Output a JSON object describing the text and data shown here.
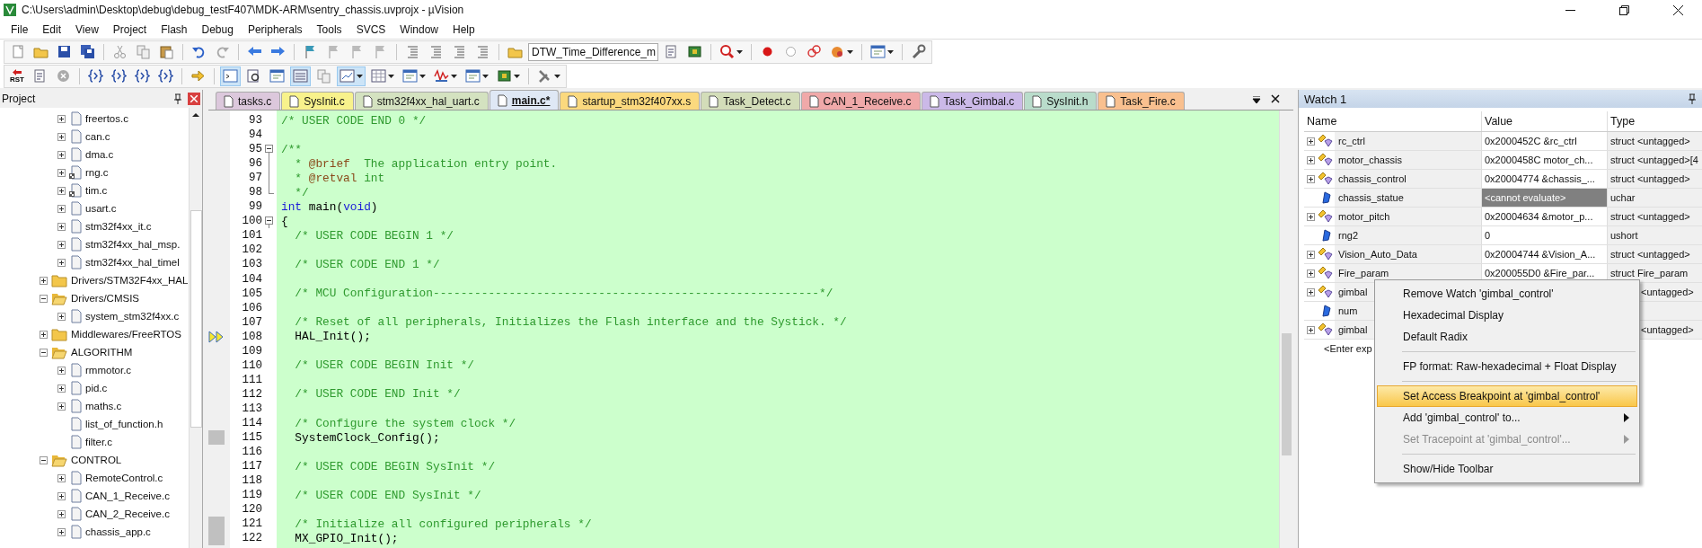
{
  "window": {
    "title": "C:\\Users\\admin\\Desktop\\debug\\debug_testF407\\MDK-ARM\\sentry_chassis.uvprojx - µVision"
  },
  "menu": [
    "File",
    "Edit",
    "View",
    "Project",
    "Flash",
    "Debug",
    "Peripherals",
    "Tools",
    "SVCS",
    "Window",
    "Help"
  ],
  "toolbar": {
    "target": "DTW_Time_Difference_m",
    "reset_label": "RST"
  },
  "project": {
    "title": "Project",
    "tree": [
      {
        "children": [
          {
            "label": "freertos.c",
            "expanded": false
          },
          {
            "label": "can.c",
            "expanded": false
          },
          {
            "label": "dma.c",
            "expanded": false
          },
          {
            "label": "rng.c",
            "expanded": false,
            "options": true
          },
          {
            "label": "tim.c",
            "expanded": false,
            "options": true
          },
          {
            "label": "usart.c",
            "expanded": false
          },
          {
            "label": "stm32f4xx_it.c",
            "expanded": false
          },
          {
            "label": "stm32f4xx_hal_msp.",
            "expanded": false
          },
          {
            "label": "stm32f4xx_hal_timel",
            "expanded": false
          }
        ]
      },
      {
        "label": "Drivers/STM32F4xx_HAL",
        "expanded": false,
        "folder": true
      },
      {
        "label": "Drivers/CMSIS",
        "expanded": true,
        "folder": true,
        "children": [
          {
            "label": "system_stm32f4xx.c",
            "expanded": false
          }
        ]
      },
      {
        "label": "Middlewares/FreeRTOS",
        "expanded": false,
        "folder": true
      },
      {
        "label": "ALGORITHM",
        "expanded": true,
        "folder": true,
        "children": [
          {
            "label": "rmmotor.c",
            "expanded": false
          },
          {
            "label": "pid.c",
            "expanded": false
          },
          {
            "label": "maths.c",
            "expanded": false
          },
          {
            "label": "list_of_function.h"
          },
          {
            "label": "filter.c"
          }
        ]
      },
      {
        "label": "CONTROL",
        "expanded": true,
        "folder": true,
        "children": [
          {
            "label": "RemoteControl.c",
            "expanded": false
          },
          {
            "label": "CAN_1_Receive.c",
            "expanded": false
          },
          {
            "label": "CAN_2_Receive.c",
            "expanded": false
          },
          {
            "label": "chassis_app.c",
            "expanded": false
          }
        ]
      }
    ]
  },
  "tabs": [
    {
      "label": "tasks.c",
      "color": "#dcc8dc",
      "selected": false
    },
    {
      "label": "SysInit.c",
      "color": "#f8f28c",
      "selected": false
    },
    {
      "label": "stm32f4xx_hal_uart.c",
      "color": "#d4e2c0",
      "selected": false
    },
    {
      "label": "main.c*",
      "color": "#dfe8f5",
      "selected": true
    },
    {
      "label": "startup_stm32f407xx.s",
      "color": "#fbd97e",
      "selected": false
    },
    {
      "label": "Task_Detect.c",
      "color": "#d3ddb9",
      "selected": false
    },
    {
      "label": "CAN_1_Receive.c",
      "color": "#f0a9a9",
      "selected": false
    },
    {
      "label": "Task_Gimbal.c",
      "color": "#cbb9e8",
      "selected": false
    },
    {
      "label": "SysInit.h",
      "color": "#b9dccb",
      "selected": false
    },
    {
      "label": "Task_Fire.c",
      "color": "#f9c08f",
      "selected": false
    }
  ],
  "code": [
    {
      "number": "93",
      "segments": [
        {
          "kind": "comment",
          "text": "/* USER CODE END 0 */"
        }
      ]
    },
    {
      "number": "94"
    },
    {
      "number": "95",
      "fold_start": true,
      "segments": [
        {
          "kind": "comment",
          "text": "/**"
        }
      ]
    },
    {
      "number": "96",
      "in_fold": true,
      "segments": [
        {
          "kind": "comment",
          "text": "  * "
        },
        {
          "kind": "tag",
          "text": "@brief"
        },
        {
          "kind": "comment",
          "text": "  The application entry point."
        }
      ]
    },
    {
      "number": "97",
      "in_fold": true,
      "segments": [
        {
          "kind": "comment",
          "text": "  * "
        },
        {
          "kind": "tag",
          "text": "@retval"
        },
        {
          "kind": "comment",
          "text": " int"
        }
      ]
    },
    {
      "number": "98",
      "fold_end": true,
      "segments": [
        {
          "kind": "comment",
          "text": "  */"
        }
      ]
    },
    {
      "number": "99",
      "segments": [
        {
          "kind": "keyword",
          "text": "int"
        },
        {
          "kind": "code",
          "text": " main("
        },
        {
          "kind": "keyword",
          "text": "void"
        },
        {
          "kind": "code",
          "text": ")"
        }
      ]
    },
    {
      "number": "100",
      "fold_start": true,
      "segments": [
        {
          "kind": "code",
          "text": "{"
        }
      ]
    },
    {
      "number": "101",
      "segments": [
        {
          "kind": "comment",
          "text": "  /* USER CODE BEGIN 1 */"
        }
      ]
    },
    {
      "number": "102"
    },
    {
      "number": "103",
      "segments": [
        {
          "kind": "comment",
          "text": "  /* USER CODE END 1 */"
        }
      ]
    },
    {
      "number": "104"
    },
    {
      "number": "105",
      "segments": [
        {
          "kind": "comment",
          "text": "  /* MCU Configuration--------------------------------------------------------*/"
        }
      ]
    },
    {
      "number": "106"
    },
    {
      "number": "107",
      "segments": [
        {
          "kind": "comment",
          "text": "  /* Reset of all peripherals, Initializes the Flash interface and the Systick. */"
        }
      ]
    },
    {
      "number": "108",
      "current": true,
      "segments": [
        {
          "kind": "code",
          "text": "  HAL_Init();"
        }
      ]
    },
    {
      "number": "109"
    },
    {
      "number": "110",
      "segments": [
        {
          "kind": "comment",
          "text": "  /* USER CODE BEGIN Init */"
        }
      ]
    },
    {
      "number": "111"
    },
    {
      "number": "112",
      "segments": [
        {
          "kind": "comment",
          "text": "  /* USER CODE END Init */"
        }
      ]
    },
    {
      "number": "113"
    },
    {
      "number": "114",
      "segments": [
        {
          "kind": "comment",
          "text": "  /* Configure the system clock */"
        }
      ]
    },
    {
      "number": "115",
      "executable": true,
      "segments": [
        {
          "kind": "code",
          "text": "  SystemClock_Config();"
        }
      ]
    },
    {
      "number": "116"
    },
    {
      "number": "117",
      "segments": [
        {
          "kind": "comment",
          "text": "  /* USER CODE BEGIN SysInit */"
        }
      ]
    },
    {
      "number": "118"
    },
    {
      "number": "119",
      "segments": [
        {
          "kind": "comment",
          "text": "  /* USER CODE END SysInit */"
        }
      ]
    },
    {
      "number": "120"
    },
    {
      "number": "121",
      "executable": true,
      "segments": [
        {
          "kind": "comment",
          "text": "  /* Initialize all configured peripherals */"
        }
      ]
    },
    {
      "number": "122",
      "executable": true,
      "segments": [
        {
          "kind": "code",
          "text": "  MX_GPIO_Init();"
        }
      ]
    }
  ],
  "watch": {
    "title": "Watch 1",
    "columns": [
      "Name",
      "Value",
      "Type"
    ],
    "rows": [
      {
        "name": "rc_ctrl",
        "value": "0x2000452C &rc_ctrl",
        "type": "struct <untagged>",
        "kind": "struct",
        "expanded": false
      },
      {
        "name": "motor_chassis",
        "value": "0x2000458C motor_ch...",
        "type": "struct <untagged>[4",
        "kind": "struct",
        "expanded": false
      },
      {
        "name": "chassis_control",
        "value": "0x20004774 &chassis_...",
        "type": "struct <untagged>",
        "kind": "struct",
        "expanded": false
      },
      {
        "name": "chassis_statue",
        "value": "<cannot evaluate>",
        "type": "uchar",
        "kind": "scalar",
        "unavailable": true
      },
      {
        "name": "motor_pitch",
        "value": "0x20004634 &motor_p...",
        "type": "struct <untagged>",
        "kind": "struct",
        "expanded": false
      },
      {
        "name": "rng2",
        "value": "0",
        "type": "ushort",
        "kind": "scalar"
      },
      {
        "name": "Vision_Auto_Data",
        "value": "0x20004744 &Vision_A...",
        "type": "struct <untagged>",
        "kind": "struct",
        "expanded": false
      },
      {
        "name": "Fire_param",
        "value": "0x200055D0 &Fire_par...",
        "type": "struct Fire_param",
        "kind": "struct",
        "expanded": false
      },
      {
        "name": "gimbal",
        "type": "<untagged>",
        "type_partial": true,
        "kind": "struct",
        "expanded": false
      },
      {
        "name": "num",
        "kind": "scalar"
      },
      {
        "name": "gimbal",
        "type": "<untagged>",
        "type_partial": true,
        "kind": "struct",
        "expanded": false
      }
    ],
    "enter_hint": "<Enter exp"
  },
  "context_menu": [
    {
      "kind": "item",
      "label": "Remove Watch 'gimbal_control'",
      "selected": false,
      "disabled": false
    },
    {
      "kind": "item",
      "label": "Hexadecimal Display",
      "selected": false,
      "disabled": false
    },
    {
      "kind": "item",
      "label": "Default Radix",
      "selected": false,
      "disabled": false
    },
    {
      "kind": "separator"
    },
    {
      "kind": "item",
      "label": "FP format: Raw-hexadecimal + Float Display",
      "selected": false,
      "disabled": false
    },
    {
      "kind": "separator"
    },
    {
      "kind": "item",
      "label": "Set Access Breakpoint at 'gimbal_control'",
      "selected": true,
      "disabled": false
    },
    {
      "kind": "item",
      "label": "Add 'gimbal_control' to...",
      "selected": false,
      "disabled": false,
      "submenu": true
    },
    {
      "kind": "item",
      "label": "Set Tracepoint at 'gimbal_control'...",
      "selected": false,
      "disabled": true,
      "submenu": true
    },
    {
      "kind": "separator"
    },
    {
      "kind": "item",
      "label": "Show/Hide Toolbar",
      "selected": false,
      "disabled": false
    }
  ]
}
